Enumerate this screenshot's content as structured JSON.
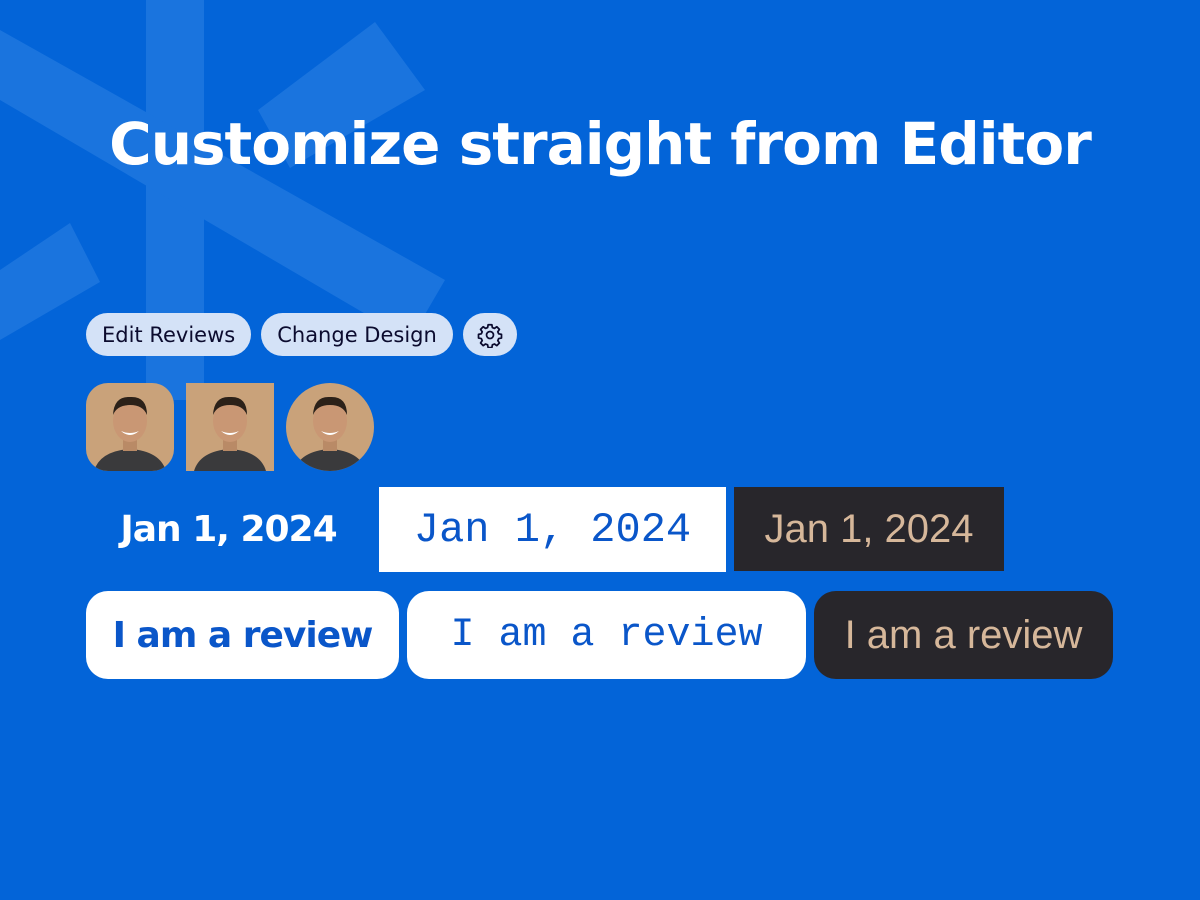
{
  "colors": {
    "background": "#0364d8",
    "accent_blue": "#0a56c9",
    "pill_background": "#d4e2f7",
    "dark_card": "#28262b",
    "dark_card_text": "#d6b79a"
  },
  "headline": "Customize straight from Editor",
  "toolbar": {
    "edit_reviews_label": "Edit Reviews",
    "change_design_label": "Change Design",
    "settings_icon": "gear-icon"
  },
  "avatars": [
    {
      "shape": "rounded-square",
      "icon": "avatar-photo"
    },
    {
      "shape": "square",
      "icon": "avatar-photo"
    },
    {
      "shape": "circle",
      "icon": "avatar-photo"
    }
  ],
  "date_styles": [
    {
      "style": "bold-sans",
      "text": "Jan 1, 2024"
    },
    {
      "style": "monospace-on-white",
      "text": "Jan 1, 2024"
    },
    {
      "style": "serif-on-dark",
      "text": "Jan 1, 2024"
    }
  ],
  "review_styles": [
    {
      "style": "bold-sans-on-white",
      "text": "I am a review"
    },
    {
      "style": "monospace-on-white",
      "text": "I am a review"
    },
    {
      "style": "sans-on-dark",
      "text": "I am a review"
    }
  ]
}
